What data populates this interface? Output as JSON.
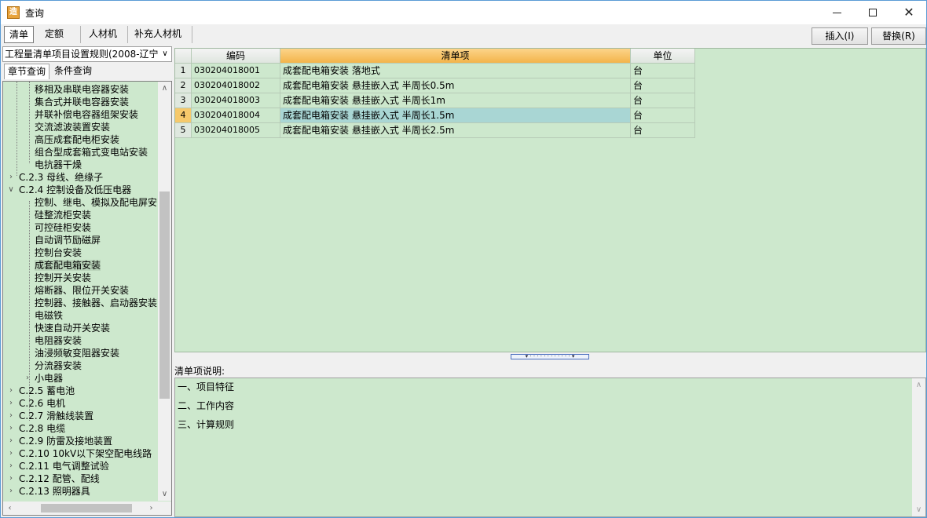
{
  "window": {
    "title": "查询",
    "icon": "app-logo-icon"
  },
  "tabs": [
    "清单",
    "定额",
    "人材机",
    "补充人材机"
  ],
  "toolbar": {
    "insert_label": "插入(I)",
    "replace_label": "替换(R)"
  },
  "rule_select": {
    "value": "工程量清单项目设置规则(2008-辽宁"
  },
  "query_tabs": [
    "章节查询",
    "条件查询"
  ],
  "tree": {
    "nodes": [
      {
        "label": "移相及串联电容器安装"
      },
      {
        "label": "集合式并联电容器安装"
      },
      {
        "label": "并联补偿电容器组架安装"
      },
      {
        "label": "交流滤波装置安装"
      },
      {
        "label": "高压成套配电柜安装"
      },
      {
        "label": "组合型成套箱式变电站安装"
      },
      {
        "label": "电抗器干燥"
      },
      {
        "label": "C.2.3 母线、绝缘子"
      },
      {
        "label": "C.2.4 控制设备及低压电器"
      },
      {
        "label": "控制、继电、模拟及配电屏安"
      },
      {
        "label": "硅整流柜安装"
      },
      {
        "label": "可控硅柜安装"
      },
      {
        "label": "自动调节励磁屏"
      },
      {
        "label": "控制台安装"
      },
      {
        "label": "成套配电箱安装"
      },
      {
        "label": "控制开关安装"
      },
      {
        "label": "熔断器、限位开关安装"
      },
      {
        "label": "控制器、接触器、启动器安装"
      },
      {
        "label": "电磁铁"
      },
      {
        "label": "快速自动开关安装"
      },
      {
        "label": "电阻器安装"
      },
      {
        "label": "油浸频敏变阻器安装"
      },
      {
        "label": "分流器安装"
      },
      {
        "label": "小电器"
      },
      {
        "label": "C.2.5 蓄电池"
      },
      {
        "label": "C.2.6 电机"
      },
      {
        "label": "C.2.7 滑触线装置"
      },
      {
        "label": "C.2.8 电缆"
      },
      {
        "label": "C.2.9 防雷及接地装置"
      },
      {
        "label": "C.2.10 10kV以下架空配电线路"
      },
      {
        "label": "C.2.11 电气调整试验"
      },
      {
        "label": "C.2.12 配管、配线"
      },
      {
        "label": "C.2.13 照明器具"
      }
    ]
  },
  "grid": {
    "columns": [
      "编码",
      "清单项",
      "单位"
    ],
    "rows": [
      {
        "num": "1",
        "code": "030204018001",
        "item": "成套配电箱安装 落地式",
        "unit": "台"
      },
      {
        "num": "2",
        "code": "030204018002",
        "item": "成套配电箱安装 悬挂嵌入式 半周长0.5m",
        "unit": "台"
      },
      {
        "num": "3",
        "code": "030204018003",
        "item": "成套配电箱安装 悬挂嵌入式 半周长1m",
        "unit": "台"
      },
      {
        "num": "4",
        "code": "030204018004",
        "item": "成套配电箱安装 悬挂嵌入式 半周长1.5m",
        "unit": "台"
      },
      {
        "num": "5",
        "code": "030204018005",
        "item": "成套配电箱安装 悬挂嵌入式 半周长2.5m",
        "unit": "台"
      }
    ]
  },
  "description": {
    "label": "清单项说明:",
    "lines": [
      "一、项目特征",
      "二、工作内容",
      "三、计算规则"
    ]
  }
}
